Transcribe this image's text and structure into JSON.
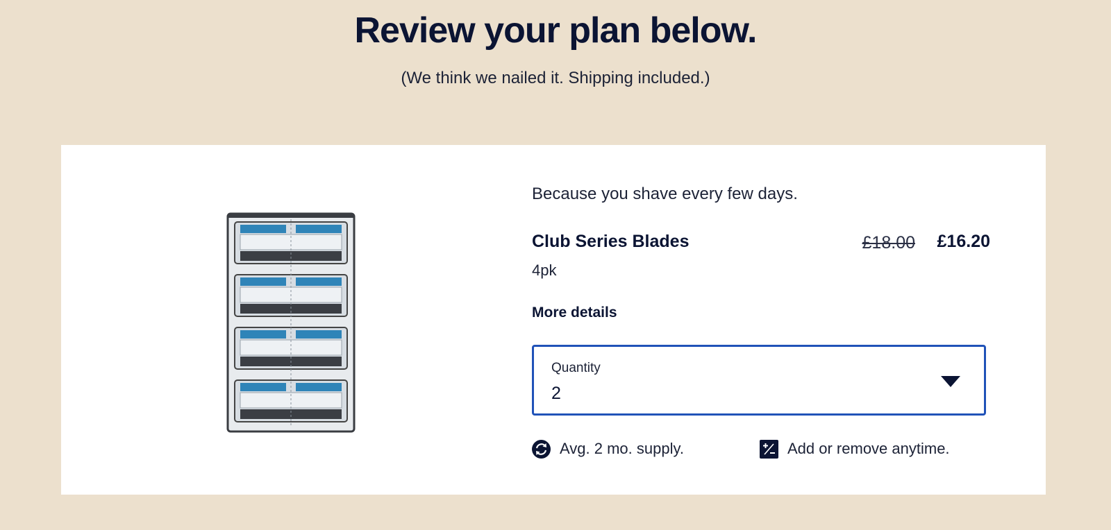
{
  "header": {
    "title": "Review your plan below.",
    "subtitle": "(We think we nailed it. Shipping included.)"
  },
  "plan": {
    "tagline": "Because you shave every few days.",
    "product_name": "Club Series Blades",
    "pack_size": "4pk",
    "price_original": "£18.00",
    "price_current": "£16.20",
    "more_details_label": "More details",
    "quantity": {
      "label": "Quantity",
      "value": "2"
    },
    "features": [
      {
        "icon": "refresh-icon",
        "text": "Avg. 2 mo. supply."
      },
      {
        "icon": "plus-minus-icon",
        "text": "Add or remove anytime."
      }
    ]
  },
  "colors": {
    "background": "#ece0cd",
    "card": "#ffffff",
    "text_dark": "#0b1433",
    "select_border": "#2052b8"
  }
}
